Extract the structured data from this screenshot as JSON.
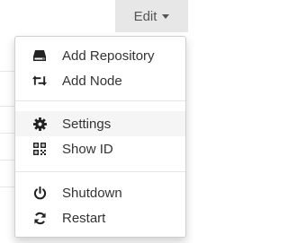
{
  "navbar": {
    "edit_menu_label": "Edit"
  },
  "edit_menu": {
    "groups": [
      {
        "items": [
          {
            "label": "Add Repository",
            "icon": "hdd-icon"
          },
          {
            "label": "Add Node",
            "icon": "retweet-icon"
          }
        ]
      },
      {
        "items": [
          {
            "label": "Settings",
            "icon": "gear-icon"
          },
          {
            "label": "Show ID",
            "icon": "qrcode-icon"
          }
        ]
      },
      {
        "items": [
          {
            "label": "Shutdown",
            "icon": "power-icon"
          },
          {
            "label": "Restart",
            "icon": "refresh-icon"
          }
        ]
      }
    ],
    "highlighted_item": "Settings"
  },
  "colors": {
    "toggle_bg": "#e7e7e7",
    "menu_border": "#cfcfcf",
    "hover_bg": "#f5f5f5",
    "text": "#333333"
  }
}
